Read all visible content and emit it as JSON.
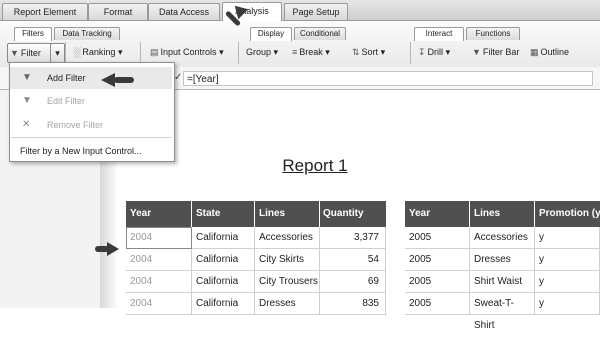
{
  "top_tabs": [
    "Report Element",
    "Format",
    "Data Access",
    "Analysis",
    "Page Setup"
  ],
  "active_top_tab": "Analysis",
  "sub_tabs": {
    "group1": [
      "Filters",
      "Data Tracking"
    ],
    "group2": [
      "Display",
      "Conditional"
    ],
    "group3": [
      "Interact",
      "Functions"
    ]
  },
  "toolbar": {
    "filter": "Filter",
    "ranking": "Ranking",
    "input_controls": "Input Controls",
    "group": "Group",
    "break": "Break",
    "sort": "Sort",
    "drill": "Drill",
    "filter_bar": "Filter Bar",
    "outline": "Outline"
  },
  "formula": {
    "text": "=[Year]"
  },
  "menu": {
    "add_filter": "Add Filter",
    "edit_filter": "Edit Filter",
    "remove_filter": "Remove Filter",
    "new_input_control": "Filter by a New Input Control..."
  },
  "report": {
    "title": "Report 1",
    "table1": {
      "headers": [
        "Year",
        "State",
        "Lines",
        "Quantity sold"
      ],
      "rows": [
        [
          "2004",
          "California",
          "Accessories",
          "3,377"
        ],
        [
          "2004",
          "California",
          "City Skirts",
          "54"
        ],
        [
          "2004",
          "California",
          "City Trousers",
          "69"
        ],
        [
          "2004",
          "California",
          "Dresses",
          "835"
        ]
      ]
    },
    "table2": {
      "headers": [
        "Year",
        "Lines",
        "Promotion (y/"
      ],
      "rows": [
        [
          "2005",
          "Accessories",
          "y"
        ],
        [
          "2005",
          "Dresses",
          "y"
        ],
        [
          "2005",
          "Shirt Waist",
          "y"
        ],
        [
          "2005",
          "Sweat-T-Shirt",
          "y"
        ]
      ]
    }
  },
  "colors": {
    "table_header": "#505050",
    "accent_arrow": "#3a3a3a"
  }
}
